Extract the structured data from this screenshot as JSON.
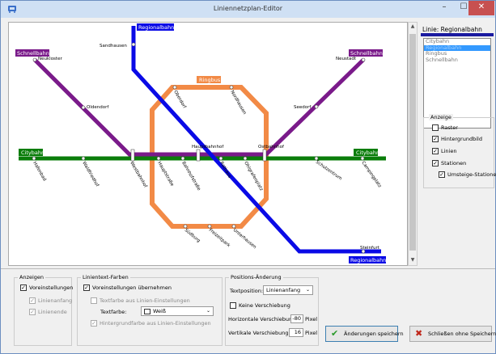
{
  "window": {
    "title": "Liniennetzplan-Editor",
    "controls": {
      "minimize": "–",
      "maximize": "☐",
      "close": "✕"
    }
  },
  "map": {
    "line_colors": {
      "Citybahn": "#0a7d0a",
      "Regionalbahn": "#0a0ae6",
      "Schnellbahn": "#7a1a8a",
      "Ringbus": "#f28a46"
    },
    "line_labels": {
      "regionalbahn_top": "Regionalbahn",
      "regionalbahn_bottom": "Regionalbahn",
      "schnellbahn_left": "Schnellbahn",
      "schnellbahn_right": "Schnellbahn",
      "citybahn_left": "Citybahn",
      "citybahn_right": "Citybahn",
      "ringbus": "Ringbus"
    },
    "stations": {
      "sandhausen": "Sandhausen",
      "neukloster": "Neukloster",
      "neustadt": "Neustadt",
      "oldendorf": "Oldendorf",
      "seedorf": "Seedorf",
      "oberdorf": "Oberdorf",
      "nordhausen": "Nordhausen",
      "hauptbahnhof": "Hauptbahnhof",
      "ostbahnhof": "Ostbahnhof",
      "hafenbad": "Hafenbad",
      "waldfriedhof": "Waldfriedhof",
      "westbahnhof": "Westbahnhof",
      "hauptstrasse": "Hauptstraße",
      "bahnhofstrasse": "Bahnhofstraße",
      "rathaus": "Rathaus",
      "ohlgrafenplatz": "Ohlgrafenplatz",
      "schulzentrum": "Schulzentrum",
      "camperplatz": "Campingplatz",
      "suedburg": "Südburg",
      "freizeitpark": "Freizeitpark",
      "unterhausen": "Unterhausen",
      "steinfurt": "Steinfurt"
    }
  },
  "side_panel": {
    "title": "Linie: Regionalbahn",
    "title_color": "#1a1aa0",
    "lines": [
      "Citybahn",
      "Regionalbahn",
      "Ringbus",
      "Schnellbahn"
    ],
    "selected_index": 1,
    "anzeige": {
      "legend": "Anzeige",
      "items": [
        {
          "label": "Raster",
          "checked": false
        },
        {
          "label": "Hintergrundbild",
          "checked": true
        },
        {
          "label": "Linien",
          "checked": true
        },
        {
          "label": "Stationen",
          "checked": true
        },
        {
          "label": "Umsteige-Stationen",
          "checked": true
        }
      ]
    }
  },
  "bottom": {
    "anzeigen": {
      "legend": "Anzeigen",
      "voreinstellungen": "Voreinstellungen",
      "linienanfang": "Linienanfang",
      "linienende": "Linienende"
    },
    "farben": {
      "legend": "Linientext-Farben",
      "voreinstellungen": "Voreinstellungen übernehmen",
      "textfarbe_aus": "Textfarbe aus Linien-Einstellungen",
      "textfarbe_label": "Textfarbe:",
      "textfarbe_value": "Weiß",
      "hintergrund": "Hintergrundfarbe aus Linien-Einstellungen"
    },
    "position": {
      "legend": "Positions-Änderung",
      "textposition_label": "Textposition:",
      "textposition_value": "Linienanfang",
      "keine_verschiebung": "Keine Verschiebung",
      "horizontal_label": "Horizontale Verschiebung:",
      "horizontal_value": "-80",
      "vertical_label": "Vertikale Verschiebung:",
      "vertical_value": "16",
      "unit": "Pixel"
    },
    "buttons": {
      "save": "Änderungen speichern",
      "close": "Schließen ohne Speichern"
    }
  }
}
